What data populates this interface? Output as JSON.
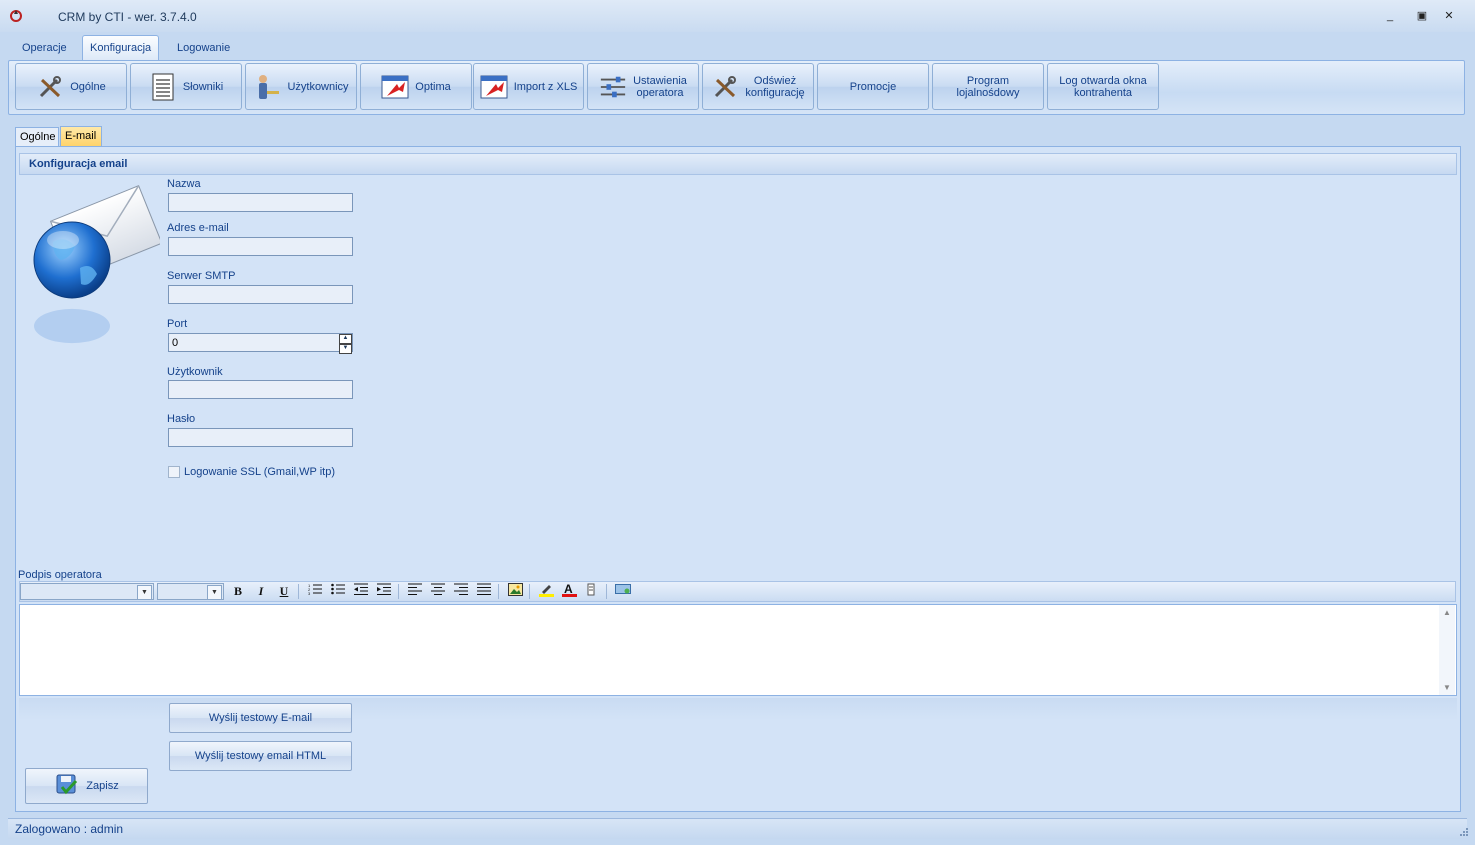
{
  "window": {
    "title": "CRM by CTI -  wer. 3.7.4.0",
    "controls": {
      "minimize": "_",
      "restore": "▣",
      "close": "✕"
    }
  },
  "ribbon_tabs": [
    {
      "label": "Operacje",
      "active": false
    },
    {
      "label": "Konfiguracja",
      "active": true
    },
    {
      "label": "Logowanie",
      "active": false
    }
  ],
  "ribbon_buttons": {
    "ogolne": "Ogólne",
    "slowniki": "Słowniki",
    "uzytkownicy": "Użytkownicy",
    "optima": "Optima",
    "import_xls": "Import z XLS",
    "ustawienia_l1": "Ustawienia",
    "ustawienia_l2": "operatora",
    "odswiez_l1": "Odśwież",
    "odswiez_l2": "konfigurację",
    "promocje": "Promocje",
    "program_l1": "Program",
    "program_l2": "lojalnośdowy",
    "log_l1": "Log otwarda okna",
    "log_l2": "kontrahenta"
  },
  "content_tabs": [
    {
      "label": "Ogólne",
      "active": false
    },
    {
      "label": "E-mail",
      "active": true
    }
  ],
  "email_config": {
    "header": "Konfiguracja email",
    "fields": {
      "nazwa": {
        "label": "Nazwa",
        "value": ""
      },
      "adres": {
        "label": "Adres e-mail",
        "value": ""
      },
      "smtp": {
        "label": "Serwer SMTP",
        "value": ""
      },
      "port": {
        "label": "Port",
        "value": "0"
      },
      "uzytkownik": {
        "label": "Użytkownik",
        "value": ""
      },
      "haslo": {
        "label": "Hasło",
        "value": ""
      }
    },
    "ssl_label": "Logowanie SSL (Gmail,WP itp)",
    "ssl_checked": false,
    "signature_label": "Podpis operatora",
    "signature_toolbar": {
      "bold": "B",
      "italic": "I",
      "underline": "U",
      "font_name": "",
      "font_size": ""
    },
    "signature_value": ""
  },
  "actions": {
    "send_test": "Wyślij testowy E-mail",
    "send_test_html": "Wyślij testowy email HTML",
    "save": "Zapisz"
  },
  "status": {
    "logged": "Zalogowano : admin"
  },
  "colors": {
    "accent": "#15428b",
    "background": "#c5d9f1",
    "active_tab": "#ffd36b"
  }
}
